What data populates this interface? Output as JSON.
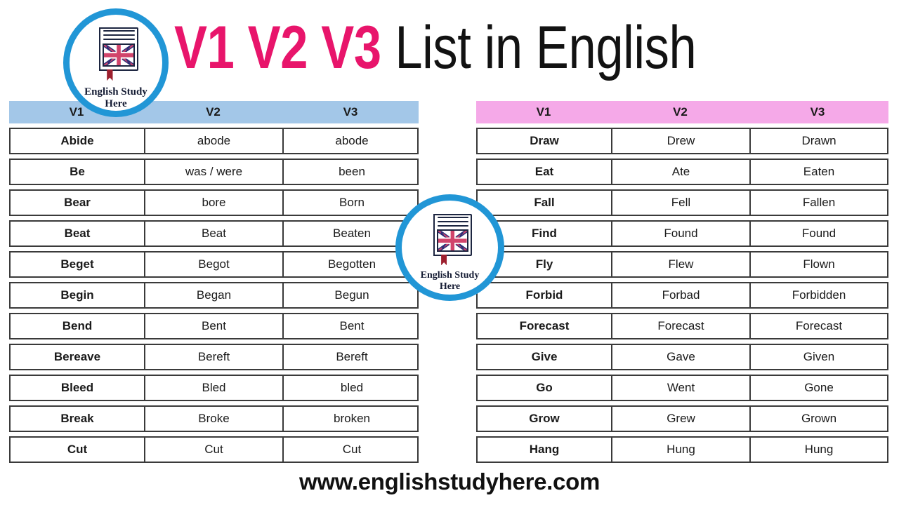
{
  "page": {
    "title_prefix": "V1 V2 V3",
    "title_suffix": "List in English",
    "footer_url": "www.englishstudyhere.com"
  },
  "logo": {
    "line1": "English Study",
    "line2": "Here",
    "ring_color": "#2196d6",
    "text_color": "#141b33"
  },
  "colors": {
    "title_accent": "#e8156b",
    "title_text": "#121212",
    "left_header_bg": "#a3c7e8",
    "right_header_bg": "#f5a9e8",
    "border": "#3a3a3a"
  },
  "tables": [
    {
      "id": "left",
      "header_bg": "#a3c7e8",
      "columns": [
        "V1",
        "V2",
        "V3"
      ],
      "rows": [
        [
          "Abide",
          "abode",
          "abode"
        ],
        [
          "Be",
          "was / were",
          "been"
        ],
        [
          "Bear",
          "bore",
          "Born"
        ],
        [
          "Beat",
          "Beat",
          "Beaten"
        ],
        [
          "Beget",
          "Begot",
          "Begotten"
        ],
        [
          "Begin",
          "Began",
          "Begun"
        ],
        [
          "Bend",
          "Bent",
          "Bent"
        ],
        [
          "Bereave",
          "Bereft",
          "Bereft"
        ],
        [
          "Bleed",
          "Bled",
          "bled"
        ],
        [
          "Break",
          "Broke",
          "broken"
        ],
        [
          "Cut",
          "Cut",
          "Cut"
        ]
      ]
    },
    {
      "id": "right",
      "header_bg": "#f5a9e8",
      "columns": [
        "V1",
        "V2",
        "V3"
      ],
      "rows": [
        [
          "Draw",
          "Drew",
          "Drawn"
        ],
        [
          "Eat",
          "Ate",
          "Eaten"
        ],
        [
          "Fall",
          "Fell",
          "Fallen"
        ],
        [
          "Find",
          "Found",
          "Found"
        ],
        [
          "Fly",
          "Flew",
          "Flown"
        ],
        [
          "Forbid",
          "Forbad",
          "Forbidden"
        ],
        [
          "Forecast",
          "Forecast",
          "Forecast"
        ],
        [
          "Give",
          "Gave",
          "Given"
        ],
        [
          "Go",
          "Went",
          "Gone"
        ],
        [
          "Grow",
          "Grew",
          "Grown"
        ],
        [
          "Hang",
          "Hung",
          "Hung"
        ]
      ]
    }
  ]
}
